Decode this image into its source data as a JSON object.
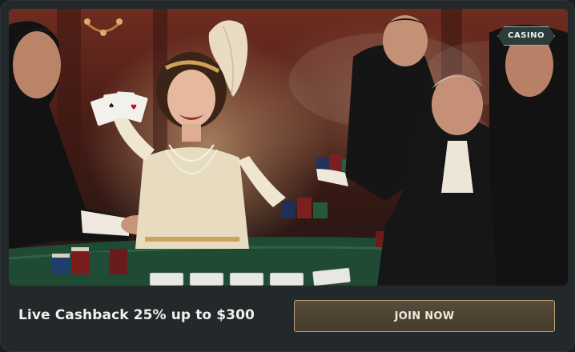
{
  "hero": {
    "badge_label": "CASINO",
    "image_alt": "1920s casino scene with a smiling flapper woman holding playing cards and gentlemen placing poker chips on a green table"
  },
  "promo": {
    "text": "Live Cashback 25% up to $300"
  },
  "cta": {
    "label": "JOIN NOW"
  },
  "colors": {
    "card_bg": "#23292a",
    "button_bg": "#4f4433",
    "button_border": "#b8a27b",
    "badge_border": "#8fb0ac"
  }
}
